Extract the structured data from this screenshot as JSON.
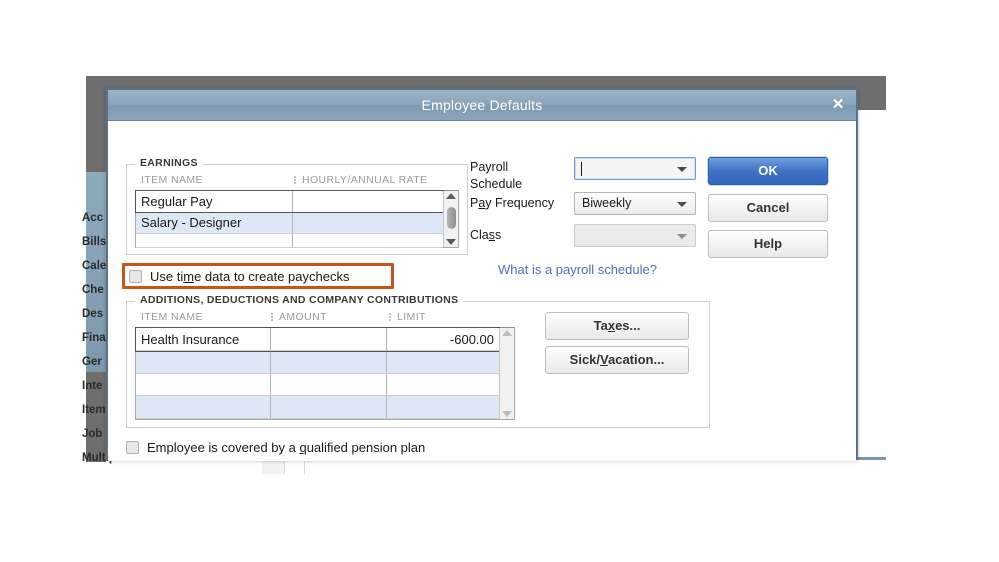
{
  "dialog": {
    "title": "Employee Defaults",
    "close_icon": "close-icon"
  },
  "earnings": {
    "legend": "EARNINGS",
    "columns": [
      "ITEM NAME",
      "HOURLY/ANNUAL RATE"
    ],
    "rows": [
      {
        "item_name": "Regular Pay",
        "rate": "",
        "selected": true
      },
      {
        "item_name": "Salary - Designer",
        "rate": "",
        "selected": false
      },
      {
        "item_name": "",
        "rate": "",
        "selected": false
      }
    ]
  },
  "time_data": {
    "label_pre": "Use ti",
    "label_accel": "m",
    "label_post": "e data to create paychecks",
    "checked": false,
    "highlight_color": "#c5561a"
  },
  "additions": {
    "legend": "ADDITIONS, DEDUCTIONS AND COMPANY CONTRIBUTIONS",
    "columns": [
      "ITEM NAME",
      "AMOUNT",
      "LIMIT"
    ],
    "rows": [
      {
        "item_name": "Health Insurance",
        "amount": "",
        "limit": "-600.00",
        "selected": true
      },
      {
        "item_name": "",
        "amount": "",
        "limit": "",
        "selected": false
      },
      {
        "item_name": "",
        "amount": "",
        "limit": "",
        "selected": false
      },
      {
        "item_name": "",
        "amount": "",
        "limit": "",
        "selected": false
      }
    ]
  },
  "pension": {
    "label_pre": "Employee is covered by a ",
    "label_accel": "q",
    "label_post": "ualified pension plan",
    "checked": false
  },
  "payroll_schedule": {
    "label_line1": "Payroll",
    "label_line2": "Schedule",
    "value": "",
    "placeholder": ""
  },
  "pay_frequency": {
    "label_pre": "P",
    "label_accel": "a",
    "label_post": "y Frequency",
    "value": "Biweekly"
  },
  "class_field": {
    "label_pre": "Cla",
    "label_accel": "s",
    "label_post": "s",
    "value": ""
  },
  "payroll_link": {
    "text": "What is a payroll schedule?",
    "color": "#4a6fc4"
  },
  "buttons": {
    "ok": "OK",
    "cancel": "Cancel",
    "help": "Help",
    "taxes_pre": "Ta",
    "taxes_accel": "x",
    "taxes_post": "es...",
    "sick_pre": "Sick/",
    "sick_accel": "V",
    "sick_post": "acation..."
  },
  "background": {
    "sidebar_items": [
      "Acc",
      "Bills",
      "Cale",
      "Che",
      "Des",
      "Fina",
      "Ger",
      "Inte",
      "Item",
      "Job"
    ],
    "sidebar_last": "Multiple Currencies"
  }
}
